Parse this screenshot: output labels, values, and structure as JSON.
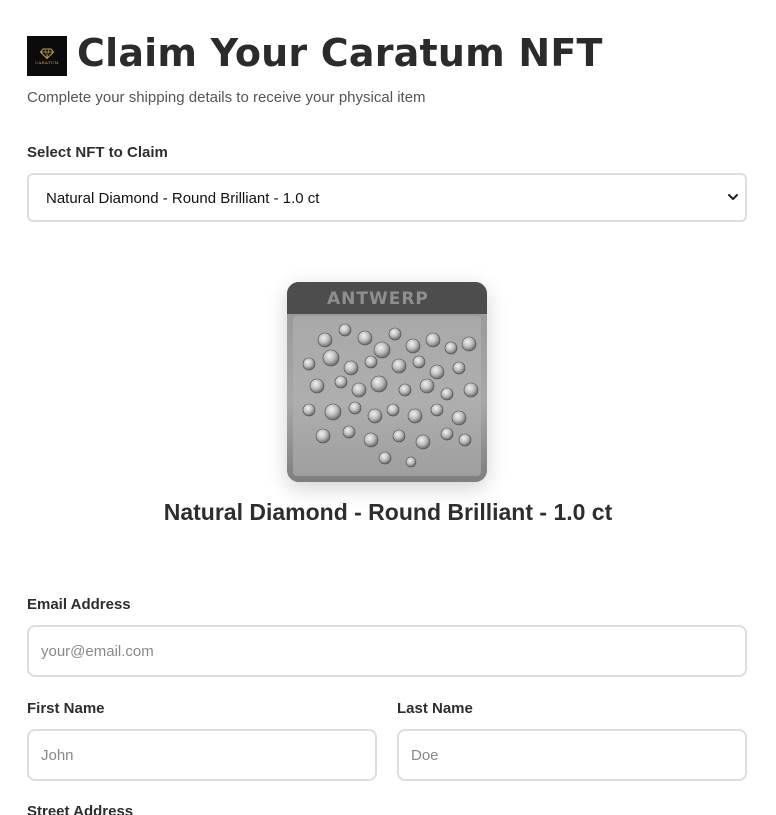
{
  "header": {
    "logo_icon": "caratum-diamond-logo",
    "logo_text": "CARATUM",
    "title": "Claim Your Caratum NFT",
    "subtitle": "Complete your shipping details to receive your physical item"
  },
  "nft_select": {
    "label": "Select NFT to Claim",
    "selected_value": "Natural Diamond - Round Brilliant - 1.0 ct",
    "chevron_icon": "chevron-down-icon"
  },
  "nft_preview": {
    "image_icon": "diamonds-photo",
    "name": "Natural Diamond - Round Brilliant - 1.0 ct"
  },
  "form": {
    "email": {
      "label": "Email Address",
      "placeholder": "your@email.com",
      "value": ""
    },
    "first_name": {
      "label": "First Name",
      "placeholder": "John",
      "value": ""
    },
    "last_name": {
      "label": "Last Name",
      "placeholder": "Doe",
      "value": ""
    },
    "street_address": {
      "label": "Street Address"
    }
  },
  "colors": {
    "text_primary": "#2b2b2b",
    "text_secondary": "#555555",
    "border": "#dddddd",
    "placeholder": "#888888",
    "logo_bg": "#0b0b0b",
    "logo_gold": "#c9a14a"
  }
}
